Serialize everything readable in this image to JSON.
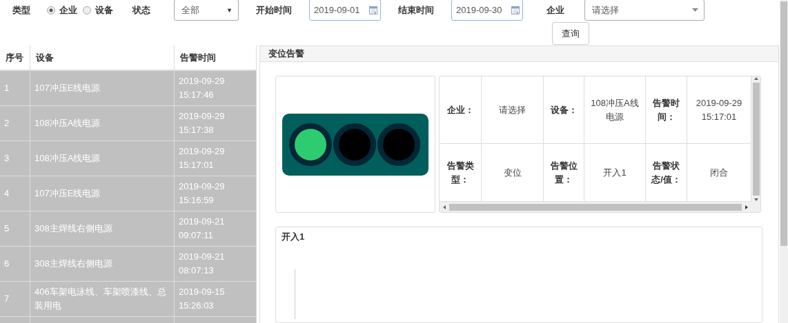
{
  "filters": {
    "type_label": "类型",
    "type_options": [
      {
        "label": "企业",
        "selected": true
      },
      {
        "label": "设备",
        "selected": false
      }
    ],
    "status_label": "状态",
    "status_value": "全部",
    "status_caret": "▼",
    "start_label": "开始时间",
    "start_value": "2019-09-01",
    "end_label": "结束时间",
    "end_value": "2019-09-30",
    "company_label": "企业",
    "company_value": "请选择",
    "query_button": "查询"
  },
  "table": {
    "columns": [
      "序号",
      "设备",
      "告警时间"
    ],
    "rows": [
      {
        "no": "1",
        "device": "107冲压E线电源",
        "time": "2019-09-29 15:17:46"
      },
      {
        "no": "2",
        "device": "108冲压A线电源",
        "time": "2019-09-29 15:17:38"
      },
      {
        "no": "3",
        "device": "108冲压A线电源",
        "time": "2019-09-29 15:17:01"
      },
      {
        "no": "4",
        "device": "107冲压E线电源",
        "time": "2019-09-29 15:16:59"
      },
      {
        "no": "5",
        "device": "308主焊线右侧电源",
        "time": "2019-09-21 09:07:11"
      },
      {
        "no": "6",
        "device": "308主焊线右侧电源",
        "time": "2019-09-21 08:07:13"
      },
      {
        "no": "7",
        "device": "406车架电泳线、车架喷漆线、总装用电",
        "time": "2019-09-15 15:26:03"
      }
    ]
  },
  "detail": {
    "title": "变位告警",
    "lights": [
      {
        "on": true
      },
      {
        "on": false
      },
      {
        "on": false
      }
    ],
    "fields": [
      [
        {
          "label": "企业：",
          "value": "请选择"
        },
        {
          "label": "设备：",
          "value": "108冲压A线电源"
        },
        {
          "label": "告警时间：",
          "value": "2019-09-29 15:17:01"
        }
      ],
      [
        {
          "label": "告警类型：",
          "value": "变位"
        },
        {
          "label": "告警位置：",
          "value": "开入1"
        },
        {
          "label": "告警状态/值：",
          "value": "闭合"
        }
      ]
    ],
    "chart_title": "开入1"
  }
}
